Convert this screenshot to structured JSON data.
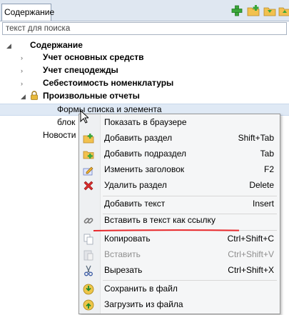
{
  "tab": {
    "label": "Содержание"
  },
  "toolbar": {
    "icons": [
      "add-green-icon",
      "add-folder-icon",
      "folder-down-icon",
      "folder-up-icon"
    ]
  },
  "search": {
    "placeholder": "текст для поиска",
    "value": ""
  },
  "tree": {
    "root": "Содержание",
    "items": [
      {
        "label": "Учет основных средств",
        "expanded": false
      },
      {
        "label": "Учет спецодежды",
        "expanded": false
      },
      {
        "label": "Себестоимость номенклатуры",
        "expanded": false
      },
      {
        "label": "Произвольные отчеты",
        "expanded": true,
        "locked": true
      }
    ],
    "children": [
      {
        "label": "Формы списка и элемента",
        "selected": true
      },
      {
        "label": "блок"
      },
      {
        "label": "Новости"
      }
    ]
  },
  "menu": {
    "items": [
      {
        "label": "Показать в браузере",
        "shortcut": ""
      },
      {
        "label": "Добавить раздел",
        "shortcut": "Shift+Tab",
        "icon": "add-section-icon"
      },
      {
        "label": "Добавить подраздел",
        "shortcut": "Tab",
        "icon": "add-subsection-icon"
      },
      {
        "label": "Изменить заголовок",
        "shortcut": "F2",
        "icon": "edit-pencil-icon"
      },
      {
        "label": "Удалить раздел",
        "shortcut": "Delete",
        "icon": "delete-x-icon"
      },
      {
        "label": "Добавить текст",
        "shortcut": "Insert"
      },
      {
        "label": "Вставить в текст как ссылку",
        "shortcut": "",
        "icon": "link-icon"
      },
      {
        "label": "Копировать",
        "shortcut": "Ctrl+Shift+C",
        "icon": "copy-icon",
        "disabled": false
      },
      {
        "label": "Вставить",
        "shortcut": "Ctrl+Shift+V",
        "icon": "paste-icon",
        "disabled": true
      },
      {
        "label": "Вырезать",
        "shortcut": "Ctrl+Shift+X",
        "icon": "cut-scissors-icon"
      },
      {
        "label": "Сохранить в файл",
        "shortcut": "",
        "icon": "save-file-icon"
      },
      {
        "label": "Загрузить из файла",
        "shortcut": "",
        "icon": "load-file-icon"
      }
    ]
  },
  "colors": {
    "accent_red": "#e8282b",
    "selection": "#dfe9f5",
    "green_plus": "#3aa63a"
  }
}
